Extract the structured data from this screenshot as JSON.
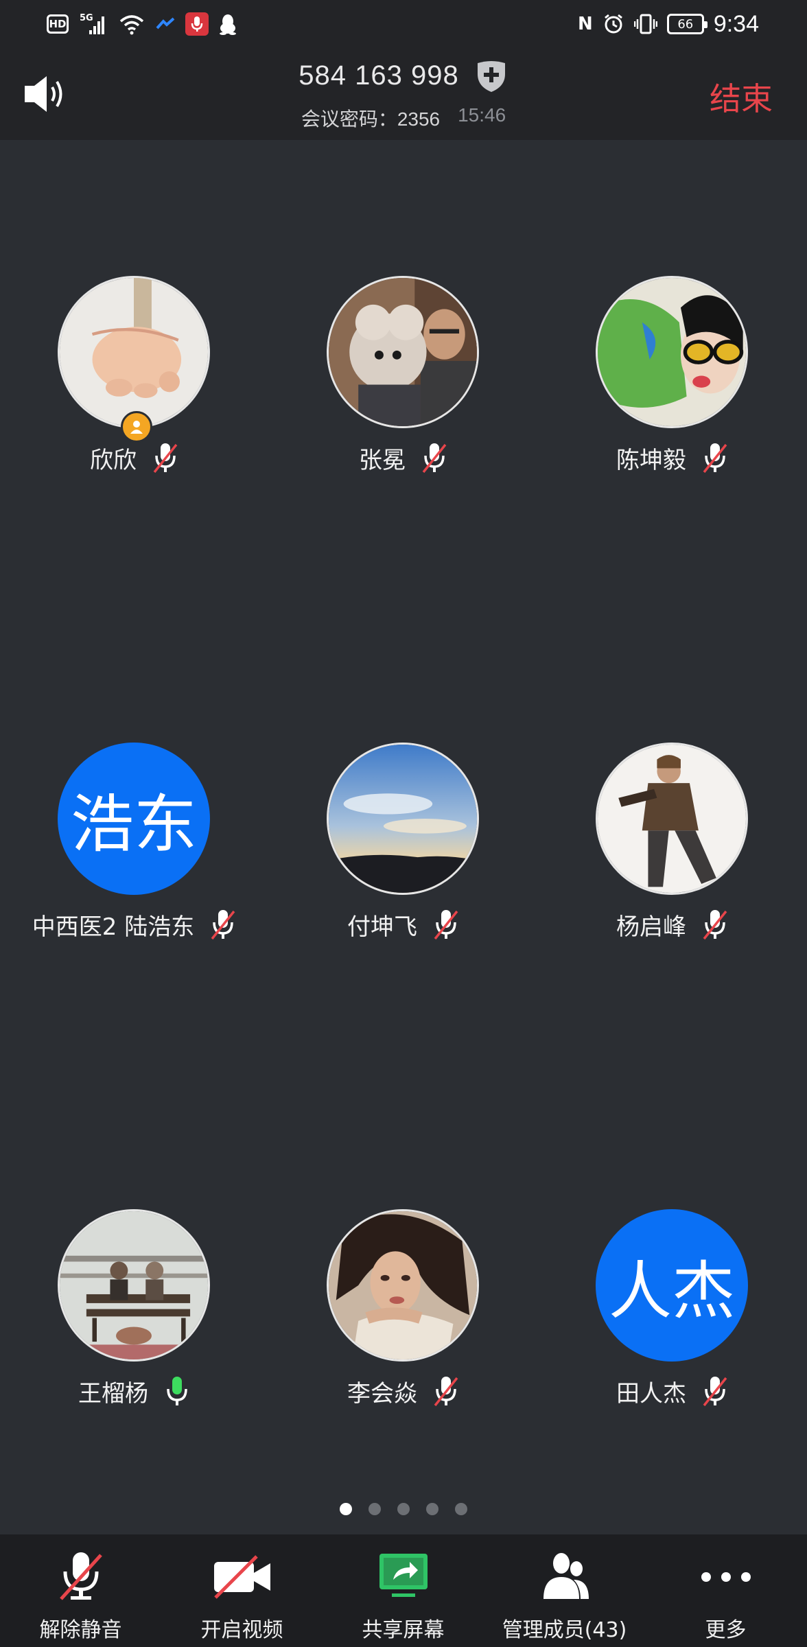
{
  "status_bar": {
    "hd_badge": "HD",
    "network_label": "5G",
    "battery": "66",
    "time": "9:34"
  },
  "meeting": {
    "id": "584 163 998",
    "password_label": "会议密码：2356",
    "duration": "15:46",
    "end_label": "结束"
  },
  "participants": [
    {
      "name": "欣欣",
      "avatar": "photo-baby-hand",
      "mic": "muted",
      "is_host": true
    },
    {
      "name": "张冕",
      "avatar": "photo-man-with-dog",
      "mic": "muted"
    },
    {
      "name": "陈坤毅",
      "avatar": "photo-woman-sunglasses",
      "mic": "muted"
    },
    {
      "name": "中西医2 陆浩东",
      "avatar_text": "浩东",
      "mic": "muted"
    },
    {
      "name": "付坤飞",
      "avatar": "photo-sky-sunset",
      "mic": "muted"
    },
    {
      "name": "杨启峰",
      "avatar": "photo-game-character",
      "mic": "muted"
    },
    {
      "name": "王榴杨",
      "avatar": "photo-bench-couple",
      "mic": "active"
    },
    {
      "name": "李会焱",
      "avatar": "photo-woman-portrait",
      "mic": "muted"
    },
    {
      "name": "田人杰",
      "avatar_text": "人杰",
      "mic": "muted"
    }
  ],
  "pagination": {
    "total": 5,
    "current": 1
  },
  "toolbar": {
    "unmute": "解除静音",
    "video": "开启视频",
    "share": "共享屏幕",
    "members": "管理成员(43)",
    "more": "更多"
  },
  "colors": {
    "background": "#2b2e33",
    "header": "#232427",
    "end_red": "#e8454b",
    "avatar_blue": "#0a70f5",
    "mic_active_green": "#3ddc5f",
    "muted_red": "#e8454b",
    "share_green": "#2fc466"
  }
}
